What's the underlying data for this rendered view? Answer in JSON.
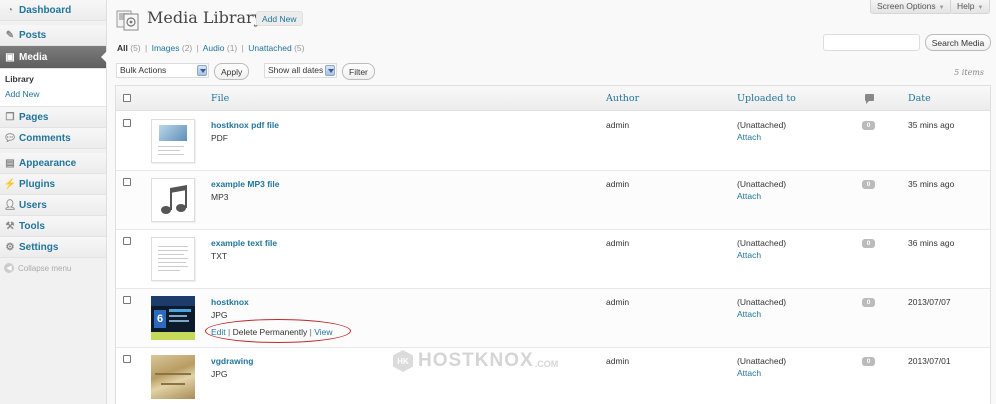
{
  "sidebar": {
    "dashboard": "Dashboard",
    "posts": "Posts",
    "media": "Media",
    "media_sub": {
      "library": "Library",
      "add_new": "Add New"
    },
    "pages": "Pages",
    "comments": "Comments",
    "appearance": "Appearance",
    "plugins": "Plugins",
    "users": "Users",
    "tools": "Tools",
    "settings": "Settings",
    "collapse": "Collapse menu"
  },
  "top": {
    "screen_options": "Screen Options",
    "help": "Help"
  },
  "header": {
    "title": "Media Library",
    "add_new": "Add New"
  },
  "filters": {
    "all": {
      "label": "All",
      "count": "(5)"
    },
    "images": {
      "label": "Images",
      "count": "(2)"
    },
    "audio": {
      "label": "Audio",
      "count": "(1)"
    },
    "unattached": {
      "label": "Unattached",
      "count": "(5)"
    }
  },
  "search": {
    "value": "",
    "button": "Search Media"
  },
  "bulk": {
    "selected": "Bulk Actions",
    "apply": "Apply"
  },
  "dates": {
    "selected": "Show all dates",
    "filter": "Filter"
  },
  "items_count": "5 items",
  "columns": {
    "file": "File",
    "author": "Author",
    "uploaded_to": "Uploaded to",
    "date": "Date"
  },
  "rows": [
    {
      "title": "hostknox pdf file",
      "type": "PDF",
      "author": "admin",
      "uploaded": "(Unattached)",
      "attach": "Attach",
      "comments": "0",
      "date": "35 mins ago",
      "thumb_icon": "pdf-document-icon"
    },
    {
      "title": "example MP3 file",
      "type": "MP3",
      "author": "admin",
      "uploaded": "(Unattached)",
      "attach": "Attach",
      "comments": "0",
      "date": "35 mins ago",
      "thumb_icon": "audio-file-icon"
    },
    {
      "title": "example text file",
      "type": "TXT",
      "author": "admin",
      "uploaded": "(Unattached)",
      "attach": "Attach",
      "comments": "0",
      "date": "36 mins ago",
      "thumb_icon": "text-document-icon"
    },
    {
      "title": "hostknox",
      "type": "JPG",
      "author": "admin",
      "uploaded": "(Unattached)",
      "attach": "Attach",
      "comments": "0",
      "date": "2013/07/07",
      "thumb_icon": "image-thumbnail",
      "actions": {
        "edit": "Edit",
        "delete": "Delete Permanently",
        "view": "View",
        "sep": "|"
      }
    },
    {
      "title": "vgdrawing",
      "type": "JPG",
      "author": "admin",
      "uploaded": "(Unattached)",
      "attach": "Attach",
      "comments": "0",
      "date": "2013/07/01",
      "thumb_icon": "image-thumbnail"
    }
  ],
  "watermark": {
    "text": "HOSTKNOX",
    "domain": ".COM",
    "badge": "HK"
  },
  "colors": {
    "link": "#21759b",
    "active_menu": "#6d6d6d",
    "highlight": "#c0282f"
  }
}
